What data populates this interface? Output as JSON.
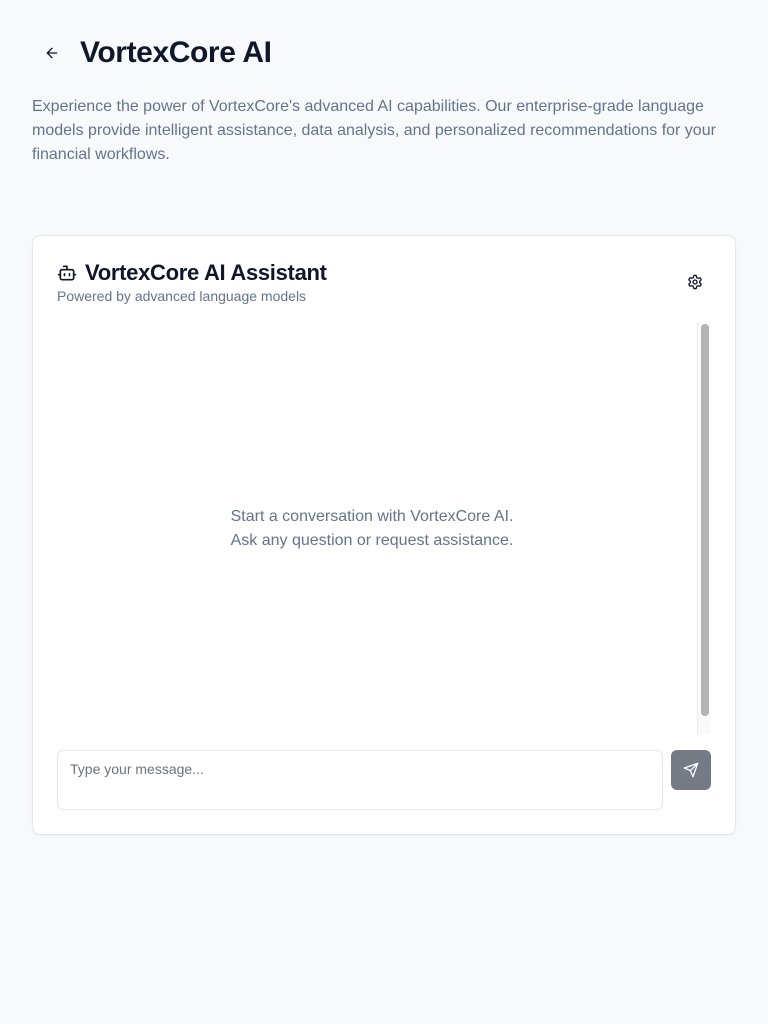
{
  "header": {
    "title": "VortexCore AI",
    "back_icon": "arrow-left-icon"
  },
  "description": "Experience the power of VortexCore's advanced AI capabilities. Our enterprise-grade language models provide intelligent assistance, data analysis, and personalized recommendations for your financial workflows.",
  "assistant": {
    "icon": "bot-icon",
    "title": "VortexCore AI Assistant",
    "subtitle": "Powered by advanced language models",
    "settings_icon": "gear-icon",
    "empty_state": {
      "line1": "Start a conversation with VortexCore AI.",
      "line2": "Ask any question or request assistance."
    },
    "input": {
      "placeholder": "Type your message...",
      "value": ""
    },
    "send_icon": "send-icon"
  },
  "colors": {
    "background": "#f8f9fb",
    "text_primary": "#0f172a",
    "text_muted": "#64748b",
    "border": "#e2e8f0",
    "send_button": "#757b85"
  }
}
